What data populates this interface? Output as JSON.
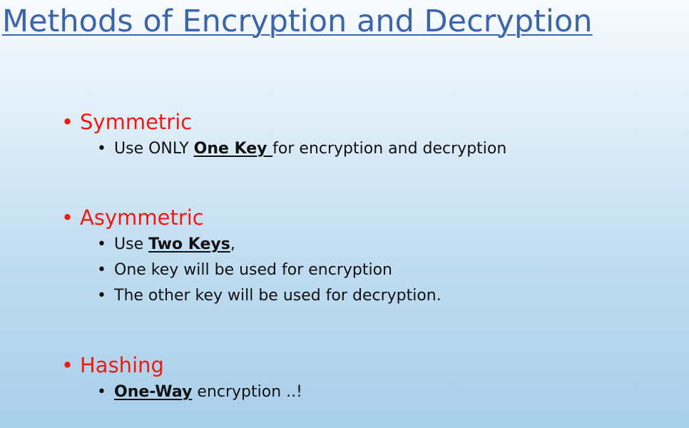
{
  "title": "Methods of Encryption and Decryption",
  "bullet_glyph": "•",
  "sections": [
    {
      "heading": "Symmetric",
      "items": [
        {
          "before": "Use ONLY ",
          "emphasis": "One Key ",
          "after": "for encryption and decryption"
        }
      ]
    },
    {
      "heading": "Asymmetric",
      "items": [
        {
          "before": "Use ",
          "emphasis": "Two Keys",
          "after": ","
        },
        {
          "text": "One key will be used for encryption"
        },
        {
          "text": "The other key will be used for decryption."
        }
      ]
    },
    {
      "heading": "Hashing",
      "items": [
        {
          "before": "",
          "emphasis": "One-Way",
          "after": " encryption ..!"
        }
      ]
    }
  ],
  "colors": {
    "title": "#3b64ad",
    "heading": "#f01a0f",
    "body_text": "#111111"
  }
}
